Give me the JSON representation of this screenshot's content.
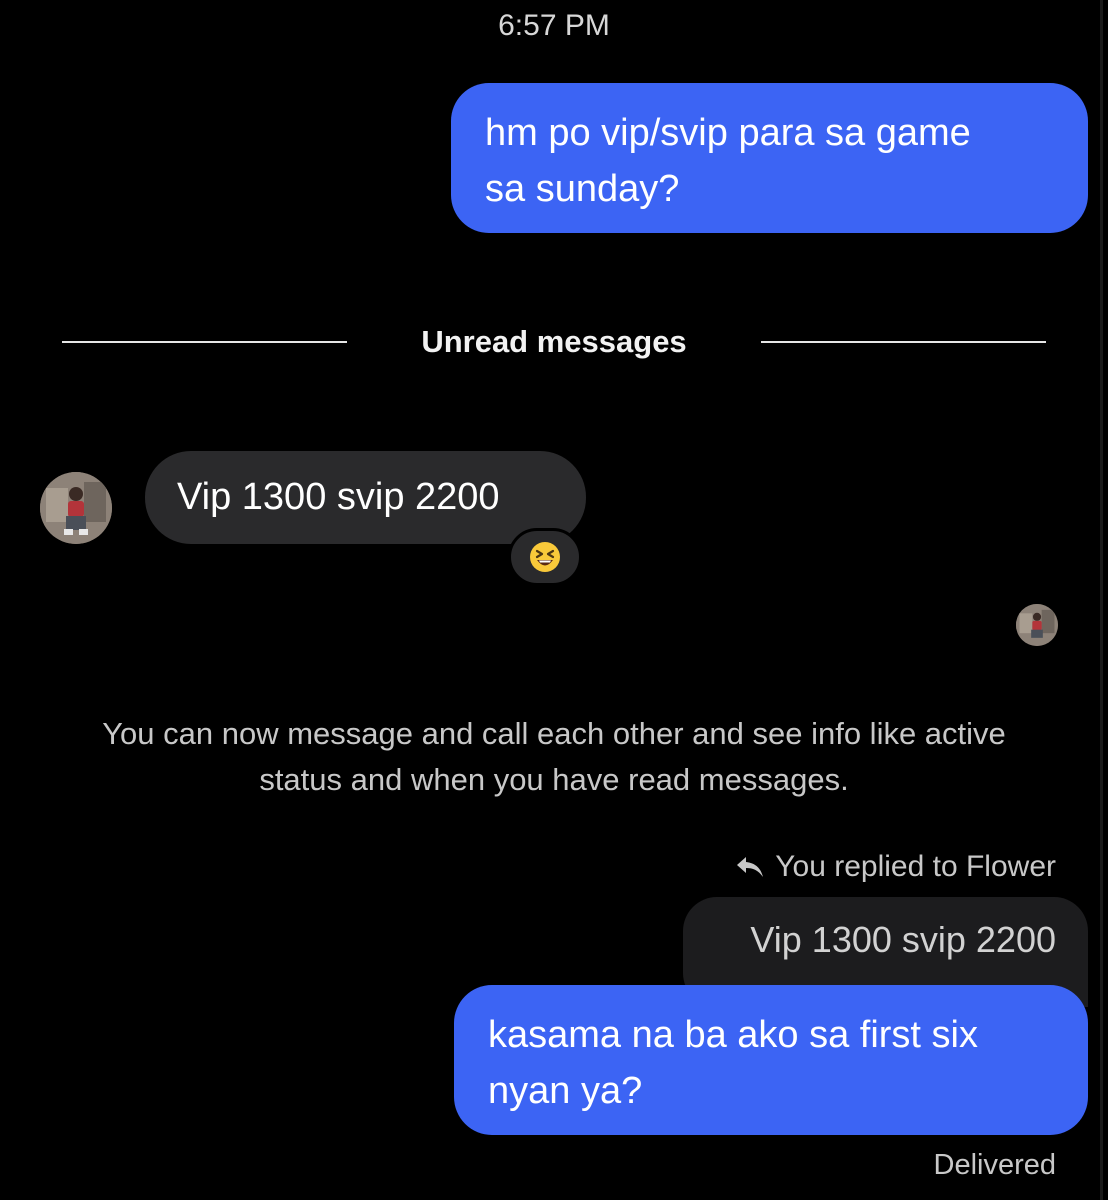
{
  "thread": {
    "timestamp": "6:57 PM",
    "messages": [
      {
        "id": "msg1",
        "direction": "outgoing",
        "lines": [
          "hm po vip/svip para sa game",
          "sa sunday?"
        ]
      }
    ],
    "unread_divider": "Unread messages",
    "incoming": {
      "text": "Vip 1300 svip 2200",
      "reaction": "grinning-squinting-face-emoji"
    },
    "info_notice": {
      "line1": "You can now message and call each other and see info like active",
      "line2": "status and when you have read messages."
    },
    "reply": {
      "label": "You replied to Flower",
      "quoted_text": "Vip 1300 svip 2200",
      "lines": [
        "kasama na ba ako sa first six",
        "nyan ya?"
      ],
      "status": "Delivered"
    }
  },
  "colors": {
    "background": "#000000",
    "outgoing_bubble": "#3c64f4",
    "incoming_bubble": "#2a2a2c",
    "quoted_bubble": "#1c1c1e",
    "muted_text": "#c8c8c8"
  },
  "icons": {
    "reply": "reply-arrow-icon",
    "avatar": "contact-avatar"
  }
}
